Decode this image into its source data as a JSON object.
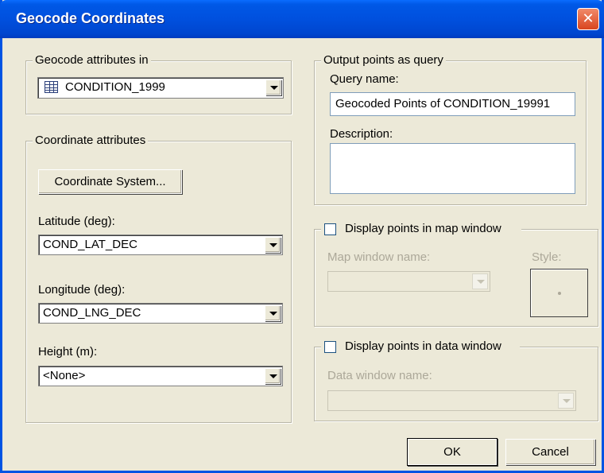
{
  "window": {
    "title": "Geocode Coordinates",
    "close_glyph": "✕"
  },
  "geocode_group": {
    "legend": "Geocode attributes in",
    "table_value": "CONDITION_1999",
    "table_icon": "table-icon"
  },
  "coord_group": {
    "legend": "Coordinate attributes",
    "coord_system_button": "Coordinate System...",
    "latitude_label": "Latitude (deg):",
    "latitude_value": "COND_LAT_DEC",
    "longitude_label": "Longitude (deg):",
    "longitude_value": "COND_LNG_DEC",
    "height_label": "Height (m):",
    "height_value": "<None>"
  },
  "output_group": {
    "legend": "Output points as query",
    "query_name_label": "Query name:",
    "query_name_value": "Geocoded Points of CONDITION_19991",
    "description_label": "Description:",
    "description_value": ""
  },
  "map_group": {
    "checkbox_label": "Display points in map window",
    "checked": false,
    "map_window_label": "Map window name:",
    "map_window_value": "",
    "style_label": "Style:"
  },
  "data_group": {
    "checkbox_label": "Display points in data window",
    "checked": false,
    "data_window_label": "Data window name:",
    "data_window_value": ""
  },
  "buttons": {
    "ok": "OK",
    "cancel": "Cancel"
  }
}
